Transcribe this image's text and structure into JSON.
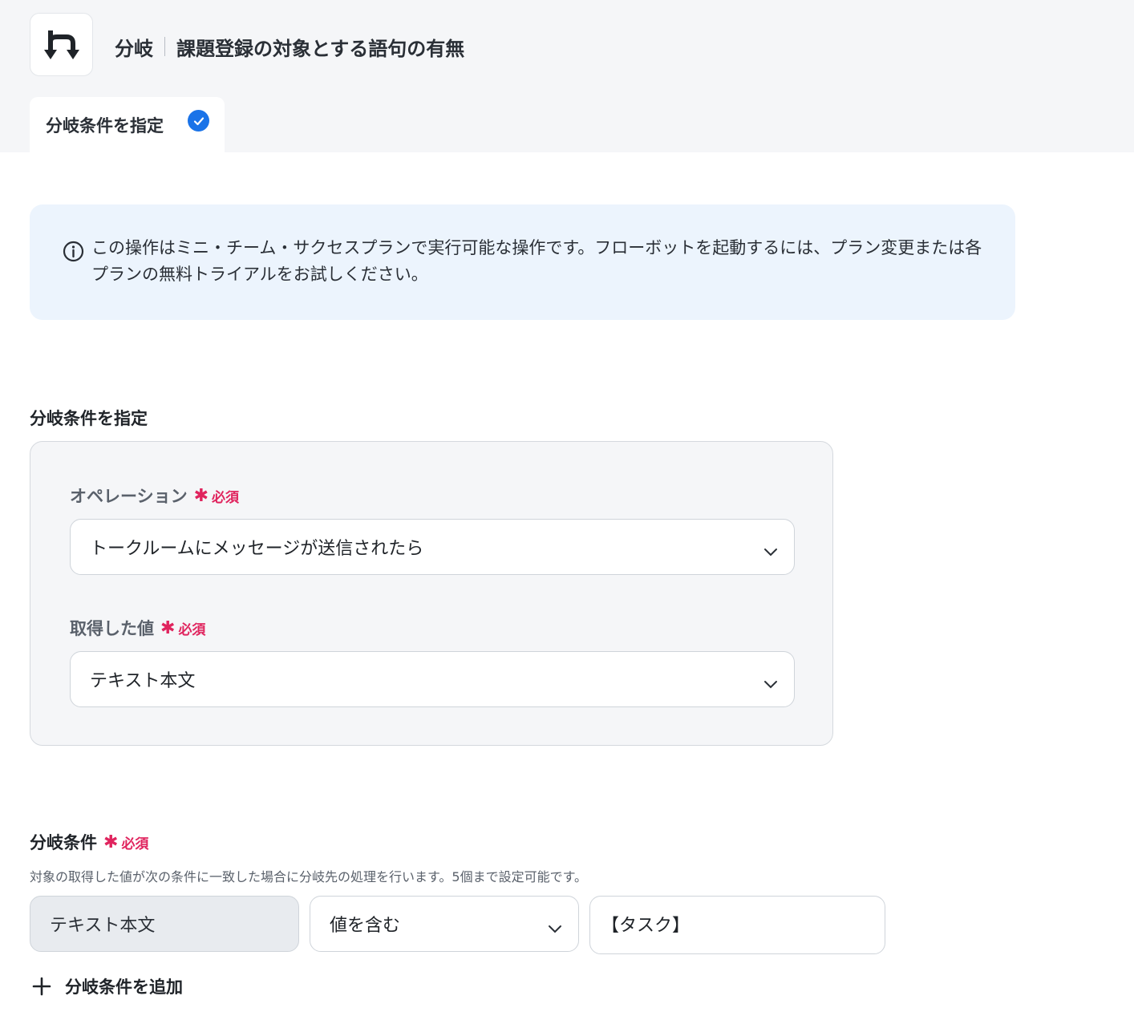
{
  "header": {
    "title_prefix": "分岐",
    "title_main": "課題登録の対象とする語句の有無",
    "tab_label": "分岐条件を指定"
  },
  "info": {
    "text": "この操作はミニ・チーム・サクセスプランで実行可能な操作です。フローボットを起動するには、プラン変更または各プランの無料トライアルをお試しください。"
  },
  "section": {
    "title": "分岐条件を指定",
    "operation_label": "オペレーション",
    "operation_value": "トークルームにメッセージが送信されたら",
    "value_label": "取得した値",
    "value_value": "テキスト本文",
    "required_text": "必須"
  },
  "conditions": {
    "title": "分岐条件",
    "description": "対象の取得した値が次の条件に一致した場合に分岐先の処理を行います。5個まで設定可能です。",
    "field": "テキスト本文",
    "operator": "値を含む",
    "value": "【タスク】",
    "add_label": "分岐条件を追加"
  },
  "colors": {
    "accent": "#1a73e8",
    "required": "#e0245e",
    "info_bg": "#ecf4fd"
  }
}
